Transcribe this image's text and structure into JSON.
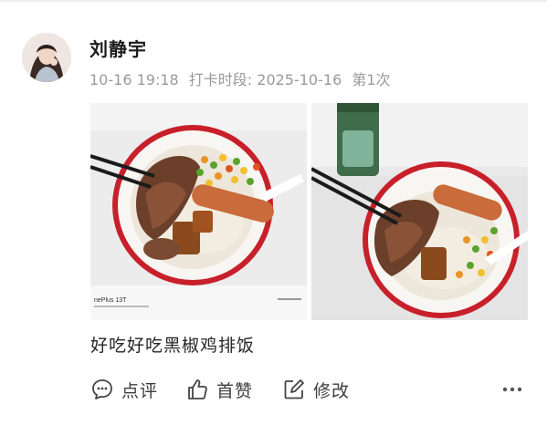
{
  "post": {
    "username": "刘静宇",
    "time": "10-16 19:18",
    "checkin_label": "打卡时段: 2025-10-16",
    "checkin_count": "第1次",
    "caption": "好吃好吃黑椒鸡排饭",
    "photo1_watermark": "nePlus 13T"
  },
  "actions": {
    "comment_label": "点评",
    "like_label": "首赞",
    "edit_label": "修改"
  },
  "icons": {
    "comment": "comment-bubble-icon",
    "like": "thumbs-up-icon",
    "edit": "edit-icon",
    "more": "more-dots-icon"
  }
}
